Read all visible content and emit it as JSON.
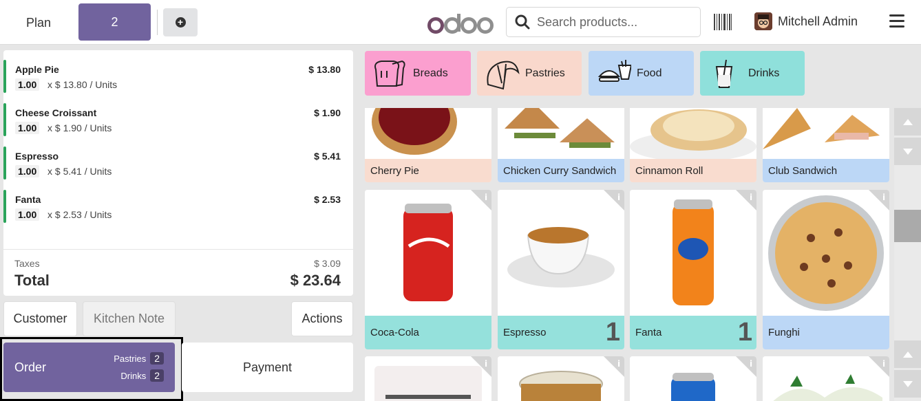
{
  "header": {
    "plan_label": "Plan",
    "table_label": "2",
    "logo_text": "odoo",
    "search_placeholder": "Search products...",
    "user_name": "Mitchell Admin"
  },
  "orderlines": [
    {
      "name": "Apple Pie",
      "price": "$ 13.80",
      "qty": "1.00",
      "unit": "x $ 13.80 / Units"
    },
    {
      "name": "Cheese Croissant",
      "price": "$ 1.90",
      "qty": "1.00",
      "unit": "x $ 1.90 / Units"
    },
    {
      "name": "Espresso",
      "price": "$ 5.41",
      "qty": "1.00",
      "unit": "x $ 5.41 / Units"
    },
    {
      "name": "Fanta",
      "price": "$ 2.53",
      "qty": "1.00",
      "unit": "x $ 2.53 / Units"
    }
  ],
  "totals": {
    "tax_label": "Taxes",
    "tax_value": "$ 3.09",
    "total_label": "Total",
    "total_value": "$ 23.64"
  },
  "controls": {
    "customer": "Customer",
    "kitchen_note": "Kitchen Note",
    "actions": "Actions",
    "order": "Order",
    "order_categories": [
      {
        "name": "Pastries",
        "count": "2"
      },
      {
        "name": "Drinks",
        "count": "2"
      }
    ],
    "payment": "Payment"
  },
  "categories": [
    {
      "label": "Breads",
      "color": "#fb9fcf"
    },
    {
      "label": "Pastries",
      "color": "#f9d8cc"
    },
    {
      "label": "Food",
      "color": "#bcd7f6"
    },
    {
      "label": "Drinks",
      "color": "#8fe0db"
    }
  ],
  "products_row1": [
    {
      "name": "Cherry Pie",
      "color": "#f9dccf"
    },
    {
      "name": "Chicken Curry Sandwich",
      "color": "#bcd7f6"
    },
    {
      "name": "Cinnamon Roll",
      "color": "#f9dccf"
    },
    {
      "name": "Club Sandwich",
      "color": "#bcd7f6"
    }
  ],
  "products_row2": [
    {
      "name": "Coca-Cola",
      "color": "#95e1dc",
      "qty": ""
    },
    {
      "name": "Espresso",
      "color": "#95e1dc",
      "qty": "1"
    },
    {
      "name": "Fanta",
      "color": "#95e1dc",
      "qty": "1"
    },
    {
      "name": "Funghi",
      "color": "#bcd7f6",
      "qty": ""
    }
  ]
}
